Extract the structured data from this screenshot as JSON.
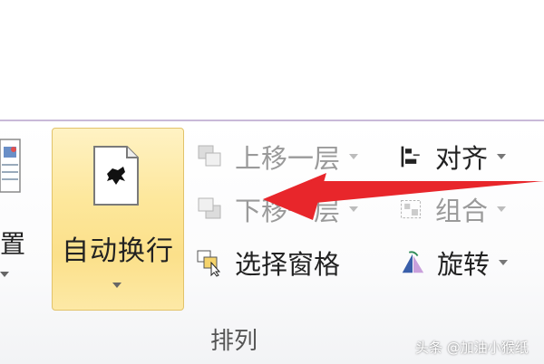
{
  "ribbon": {
    "partial_button_label": "置",
    "wrap_text_label": "自动换行",
    "group_label": "排列"
  },
  "arrange": {
    "bring_forward": "上移一层",
    "send_backward": "下移一层",
    "selection_pane": "选择窗格",
    "align": "对齐",
    "group": "组合",
    "rotate": "旋转"
  },
  "icons": {
    "position": "position-icon",
    "wrap_text": "wrap-text-icon",
    "bring_forward": "bring-forward-icon",
    "send_backward": "send-backward-icon",
    "selection_pane": "selection-pane-icon",
    "align": "align-icon",
    "group": "group-icon",
    "rotate": "rotate-icon",
    "annotation_arrow": "red-arrow"
  },
  "watermark": "头条 @加油小猴纸",
  "colors": {
    "highlight": "#fde79b",
    "highlight_border": "#e2c36a",
    "disabled_text": "#9a9a9a",
    "arrow": "#e8262b"
  }
}
